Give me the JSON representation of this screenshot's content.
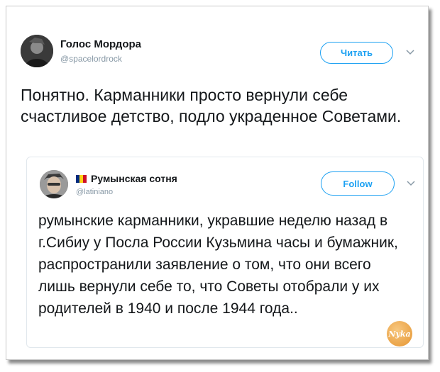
{
  "tweet": {
    "author_name": "Голос Мордора",
    "author_handle": "@spacelordrock",
    "follow_label": "Читать",
    "text": "Понятно. Карманники просто вернули себе счастливое детство, подло украденное Советами."
  },
  "quoted_tweet": {
    "author_name": "Румынская сотня",
    "author_handle": "@latiniano",
    "follow_label": "Follow",
    "flag_colors": [
      "#002b7f",
      "#fcd116",
      "#ce1126"
    ],
    "text": "румынские карманники, укравшие неделю назад в г.Сибиу у Посла России Кузьмина часы и бумажник, распространили заявление о том, что они всего лишь вернули себе то, что Советы отобрали у их родителей в 1940 и после 1944 года.."
  },
  "watermark": {
    "text": "Nyka"
  },
  "colors": {
    "accent": "#1da1f2",
    "muted": "#8899a6",
    "text": "#14171a"
  }
}
